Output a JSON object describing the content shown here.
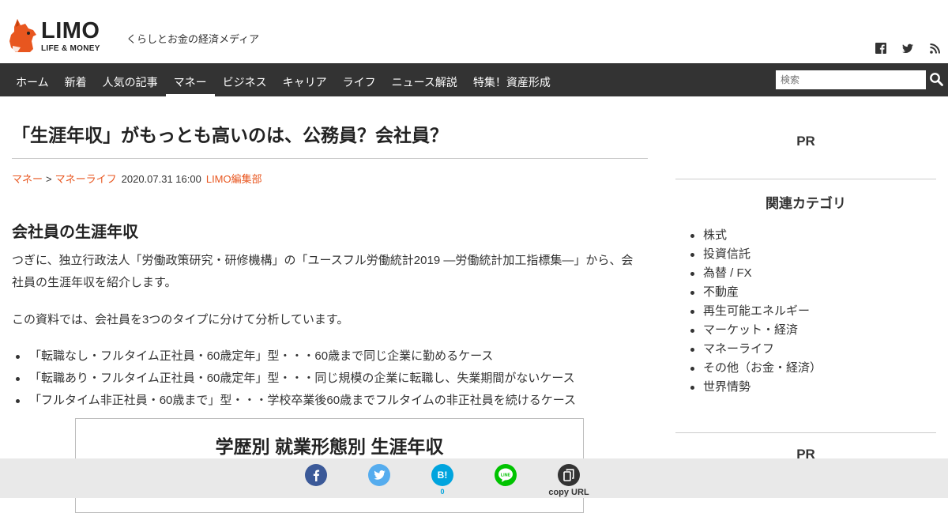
{
  "header": {
    "logo_text": "LIMO",
    "logo_sub": "LIFE & MONEY",
    "tagline": "くらしとお金の経済メディア",
    "social_icons": [
      "facebook-icon",
      "twitter-icon",
      "rss-icon"
    ]
  },
  "nav": {
    "items": [
      {
        "label": "ホーム"
      },
      {
        "label": "新着"
      },
      {
        "label": "人気の記事"
      },
      {
        "label": "マネー"
      },
      {
        "label": "ビジネス"
      },
      {
        "label": "キャリア"
      },
      {
        "label": "ライフ"
      },
      {
        "label": "ニュース解説"
      },
      {
        "label": "特集！資産形成"
      }
    ],
    "active_label": "マネー",
    "search_placeholder": "検索"
  },
  "article": {
    "title": "「生涯年収」がもっとも高いのは、公務員？会社員？",
    "breadcrumb": [
      "マネー",
      "マネーライフ"
    ],
    "breadcrumb_sep": ">",
    "date": "2020.07.31 16:00",
    "author": "LIMO編集部",
    "section_heading": "会社員の生涯年収",
    "para1": "つぎに、独立行政法人「労働政策研究・研修機構」の「ユースフル労働統計2019 ―労働統計加工指標集―」から、会社員の生涯年収を紹介します。",
    "para2": "この資料では、会社員を3つのタイプに分けて分析しています。",
    "bullets": [
      "「転職なし・フルタイム正社員・60歳定年」型・・・60歳まで同じ企業に勤めるケース",
      "「転職あり・フルタイム正社員・60歳定年」型・・・同じ規模の企業に転職し、失業期間がないケース",
      "「フルタイム非正社員・60歳まで」型・・・学校卒業後60歳までフルタイムの非正社員を続けるケース"
    ],
    "figure_title": "学歴別 就業形態別 生涯年収"
  },
  "sidebar": {
    "pr_label_1": "PR",
    "category_title": "関連カテゴリ",
    "categories": [
      "株式",
      "投資信託",
      "為替 / FX",
      "不動産",
      "再生可能エネルギー",
      "マーケット・経済",
      "マネーライフ",
      "その他（お金・経済）",
      "世界情勢"
    ],
    "pr_label_2": "PR"
  },
  "share_bar": {
    "hatena_label": "B!",
    "hatena_count": "0",
    "line_label": "LINE",
    "copy_label": "copy URL"
  },
  "colors": {
    "accent": "#e8561f",
    "nav_bg": "#333333",
    "facebook": "#3b5998",
    "twitter": "#55acee",
    "hatena": "#00a4de",
    "line": "#00c300"
  }
}
